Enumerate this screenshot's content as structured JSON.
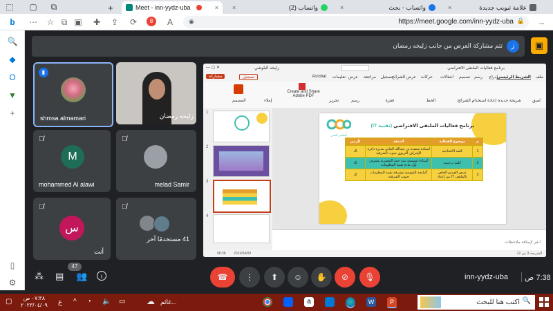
{
  "browser": {
    "tabs": [
      {
        "label": "Meet - inn-yydz-uba",
        "active": true
      },
      {
        "label": "(2) واتساب"
      },
      {
        "label": "واتساب - بحث"
      },
      {
        "label": "علامة تبويب جديدة"
      }
    ],
    "new_tab_symbol": "+",
    "close_symbol": "×",
    "url": "https://meet.google.com/inn-yydz-uba"
  },
  "banner": {
    "text": "تتم مشاركة العرض من جانب زليخه رمضان",
    "avatar_letter": "ز"
  },
  "participants": [
    {
      "name": "shmsa almamari",
      "type": "photo"
    },
    {
      "name": "زليخه رمضان",
      "type": "video"
    },
    {
      "name": "mohammed Al alawi",
      "letter": "M"
    },
    {
      "name": "melad Samir",
      "type": "blank"
    },
    {
      "name": "أنت",
      "letter": "س"
    },
    {
      "name": "41 مستخدمًا آخر",
      "type": "group"
    }
  ],
  "meeting": {
    "time": "7:38 ص",
    "code": "inn-yydz-uba",
    "people_count": "47"
  },
  "presentation": {
    "doc_title": "برنامج فعاليات الملتقى الافتراضي",
    "user_name": "زليخه البلوشي",
    "share_label": "مشاركة",
    "record_label": "تسجيل",
    "menu": [
      "ملف",
      "الشريط الرئيسي",
      "إدراج",
      "رسم",
      "تصميم",
      "انتقالات",
      "حركات",
      "عرض الشرائح",
      "تسجيل",
      "مراجعة",
      "عرض",
      "تعليمات",
      "Acrobat"
    ],
    "ribbon": [
      "لصق",
      "شريحة جديدة",
      "إعادة استخدام الشرائح",
      "الخط",
      "فقرة",
      "رسم",
      "تحرير",
      "Create and Share Adobe PDF",
      "إملاء",
      "المصمم"
    ],
    "slide": {
      "logo_caption": "الملتقى التقني",
      "title_a": "برنامج فعاليات الملتقى الافتراضي",
      "title_b": "(تقنية IT)",
      "headers": [
        "م",
        "موضوع الفعالية",
        "المنفذ",
        "الزمن"
      ],
      "rows": [
        [
          "1",
          "كلمة الافتتاحية",
          "أستاذة سعيدة بن عبدالله الخابي مديرة دائرة الإشراف التربوي جنوب الشرقية",
          "5د"
        ],
        [
          "2",
          "كلمة ترحيبية",
          "أستاذة شميسة بنت حمد المعمرية مشرف أول مادة تقنية المعلومات",
          "5د"
        ],
        [
          "3",
          "عرض الفيديو الخاص بالملتقى IT من إعداد",
          "أ/زليخة البلوشية مشرفة تقنية المعلومات جنوب الشرقية",
          "2د"
        ]
      ]
    },
    "notes_placeholder": "انقر لإضافة ملاحظات",
    "status": "الشريحة 3 من 12",
    "slide_numbers": [
      "1",
      "2",
      "3",
      "4"
    ],
    "taskbar_time": "08:38",
    "taskbar_date": "2023/04/09"
  },
  "controls": {
    "hangup_icon": "phone-hangup",
    "more_icon": "more-vertical",
    "present_icon": "present-screen",
    "emoji_icon": "emoji",
    "raise_hand_icon": "raise-hand",
    "camera_off_icon": "camera-off",
    "mic_off_icon": "mic-off",
    "info_icon": "info",
    "people_icon": "people",
    "chat_icon": "chat",
    "activities_icon": "activities"
  },
  "taskbar": {
    "search_placeholder": "اكتب هنا للبحث",
    "time": "٠٧:٣٨ ص",
    "date": "٢٠٢٣/٠٤/٠٩",
    "lang": "ع",
    "weather": "غائم..."
  },
  "colors": {
    "meet_bg": "#202124",
    "tile_bg": "#3c4043",
    "hangup": "#ea4335",
    "taskbar": "#7b1a0d",
    "table_header": "#e49d2b",
    "teal_row": "#3fbfad",
    "yellow_row": "#f6d03f"
  }
}
